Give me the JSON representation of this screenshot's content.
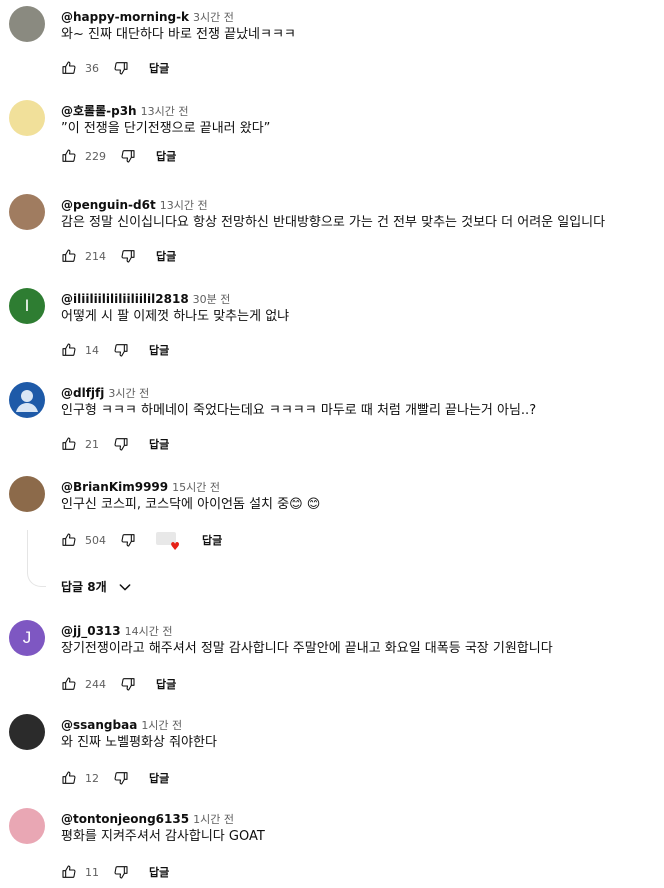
{
  "comments": [
    {
      "author": "@happy-morning-k",
      "time": "3시간 전",
      "text": "와~ 진짜 대단하다 바로 전쟁 끝났네ㅋㅋㅋ",
      "likes": "36",
      "reply": "답글",
      "avatar_color": "#8a8a80",
      "avatar_letter": ""
    },
    {
      "author": "@호롤롤-p3h",
      "time": "13시간 전",
      "text": "”이 전쟁을 단기전쟁으로 끝내러 왔다”",
      "likes": "229",
      "reply": "답글",
      "avatar_color": "#f1e09a",
      "avatar_letter": ""
    },
    {
      "author": "@penguin-d6t",
      "time": "13시간 전",
      "text": "감은 정말 신이십니다요 항상 전망하신 반대방향으로 가는 건 전부 맞추는 것보다 더 어려운 일입니다",
      "likes": "214",
      "reply": "답글",
      "avatar_color": "#a07c60",
      "avatar_letter": ""
    },
    {
      "author": "@iliiliilililiiliilil2818",
      "time": "30분 전",
      "text": "어떻게 시 팔 이제껏 하나도 맞추는게 없냐",
      "likes": "14",
      "reply": "답글",
      "avatar_color": "#2e7d32",
      "avatar_letter": "I"
    },
    {
      "author": "@dlfjfj",
      "time": "3시간 전",
      "text": "인구형 ㅋㅋㅋ 하메네이 죽었다는데요 ㅋㅋㅋㅋ 마두로 때 처럼 개빨리 끝나는거 아님..?",
      "likes": "21",
      "reply": "답글",
      "avatar_color": "#1e5aa8",
      "avatar_letter": ""
    },
    {
      "author": "@BrianKim9999",
      "time": "15시간 전",
      "text": "인구신 코스피, 코스닥에 아이언돔 설치 중😊 😊",
      "likes": "504",
      "reply": "답글",
      "avatar_color": "#8c6a4a",
      "avatar_letter": ""
    },
    {
      "author": "@jj_0313",
      "time": "14시간 전",
      "text": "장기전쟁이라고 해주셔서 정말 감사합니다 주말안에 끝내고 화요일 대폭등 국장 기원합니다",
      "likes": "244",
      "reply": "답글",
      "avatar_color": "#7e57c2",
      "avatar_letter": "J"
    },
    {
      "author": "@ssangbaa",
      "time": "1시간 전",
      "text": "와 진짜 노벨평화상 줘야한다",
      "likes": "12",
      "reply": "답글",
      "avatar_color": "#2b2b2b",
      "avatar_letter": ""
    },
    {
      "author": "@tontonjeong6135",
      "time": "1시간 전",
      "text": "평화를 지켜주셔서 감사합니다 GOAT",
      "likes": "11",
      "reply": "답글",
      "avatar_color": "#e9a7b4",
      "avatar_letter": ""
    }
  ],
  "replies_toggle": "답글 8개",
  "icons": {
    "like": "thumb-up-icon",
    "dislike": "thumb-down-icon",
    "expand": "chevron-down-icon",
    "creator_heart": "creator-heart-icon"
  }
}
